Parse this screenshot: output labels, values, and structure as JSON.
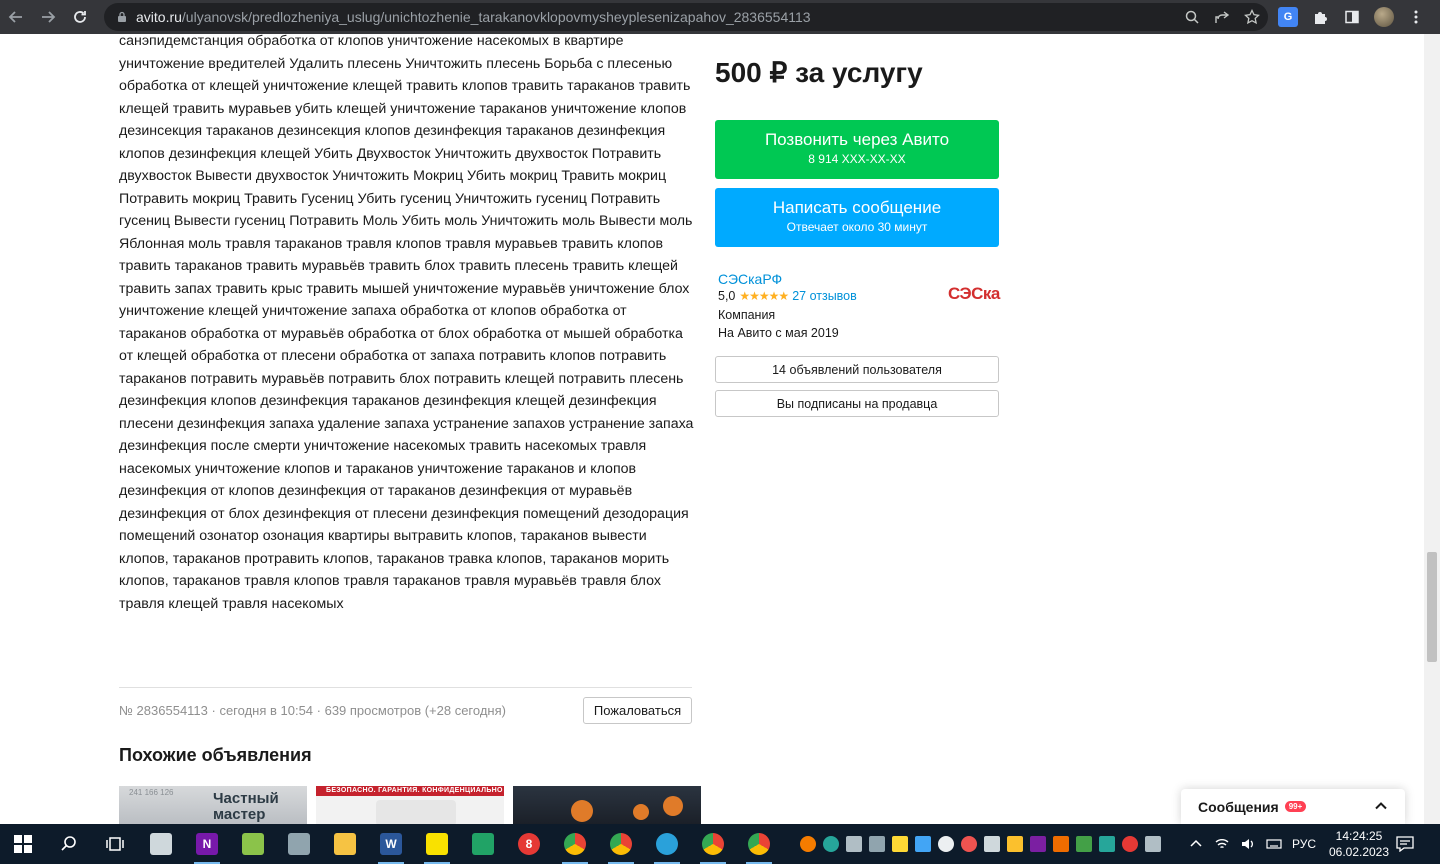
{
  "browser": {
    "url_host": "avito.ru",
    "url_path": "/ulyanovsk/predlozheniya_uslug/unichtozhenie_tarakanovklopovmysheyplesenizapahov_2836554113"
  },
  "listing": {
    "description": "санэпидемстанция обработка от клопов уничтожение насекомых в квартире уничтожение вредителей Удалить плесень Уничтожить плесень Борьба с плесенью обработка от клещей уничтожение клещей травить клопов травить тараканов травить клещей травить муравьев убить клещей уничтожение тараканов уничтожение клопов дезинсекция тараканов дезинсекция клопов дезинфекция тараканов дезинфекция клопов дезинфекция клещей Убить Двухвосток Уничтожить двухвосток Потравить двухвосток Вывести двухвосток Уничтожить Мокриц Убить мокриц Травить мокриц Потравить мокриц Травить Гусениц Убить гусениц Уничтожить гусениц Потравить гусениц Вывести гусениц Потравить Моль Убить моль Уничтожить моль Вывести моль Яблонная моль травля тараканов травля клопов травля муравьев травить клопов травить тараканов травить муравьёв травить блох травить плесень травить клещей травить запах травить крыс травить мышей уничтожение муравьёв уничтожение блох уничтожение клещей уничтожение запаха обработка от клопов обработка от тараканов обработка от муравьёв обработка от блох обработка от мышей обработка от клещей обработка от плесени обработка от запаха потравить клопов потравить тараканов потравить муравьёв потравить блох потравить клещей потравить плесень дезинфекция клопов дезинфекция тараканов дезинфекция клещей дезинфекция плесени дезинфекция запаха удаление запаха устранение запахов устранение запаха дезинфекция после смерти уничтожение насекомых травить насекомых травля насекомых уничтожение клопов и тараканов уничтожение тараканов и клопов дезинфекция от клопов дезинфекция от тараканов дезинфекция от муравьёв дезинфекция от блох дезинфекция от плесени дезинфекция помещений дезодорация помещений озонатор озонация квартиры вытравить клопов, тараканов вывести клопов, тараканов протравить клопов, тараканов травка клопов, тараканов морить клопов, тараканов травля клопов травля тараканов травля муравьёв травля блох травля клещей травля насекомых",
    "meta": "№ 2836554113 · сегодня в 10:54 · 639 просмотров (+28 сегодня)",
    "complain_label": "Пожаловаться",
    "similar_title": "Похожие объявления",
    "thumbs": [
      {
        "caption": "Частный мастер",
        "small": "241 166 126"
      },
      {
        "caption": "БЕЗОПАСНО. ГАРАНТИЯ. КОНФИДЕНЦИАЛЬНО"
      },
      {
        "caption": ""
      }
    ]
  },
  "sidebar": {
    "price": "500 ₽ за услугу",
    "call_title": "Позвонить через Авито",
    "call_sub": "8 914 XXX-XX-XX",
    "message_title": "Написать сообщение",
    "message_sub": "Отвечает около 30 минут",
    "seller_name": "СЭСкаРФ",
    "rating": "5,0",
    "stars": "★★★★★",
    "reviews": "27 отзывов",
    "seller_type": "Компания",
    "seller_since": "На Авито с мая 2019",
    "seller_logo": "СЭСка",
    "user_ads_label": "14 объявлений пользователя",
    "subscribed_label": "Вы подписаны на продавца"
  },
  "messages_panel": {
    "label": "Сообщения",
    "badge": "99+"
  },
  "taskbar": {
    "language": "РУС",
    "time": "14:24:25",
    "date": "06.02.2023"
  },
  "colors": {
    "call_button": "#00c853",
    "message_button": "#00aaff",
    "link": "#0091d9",
    "logo_red": "#d32f2f"
  }
}
